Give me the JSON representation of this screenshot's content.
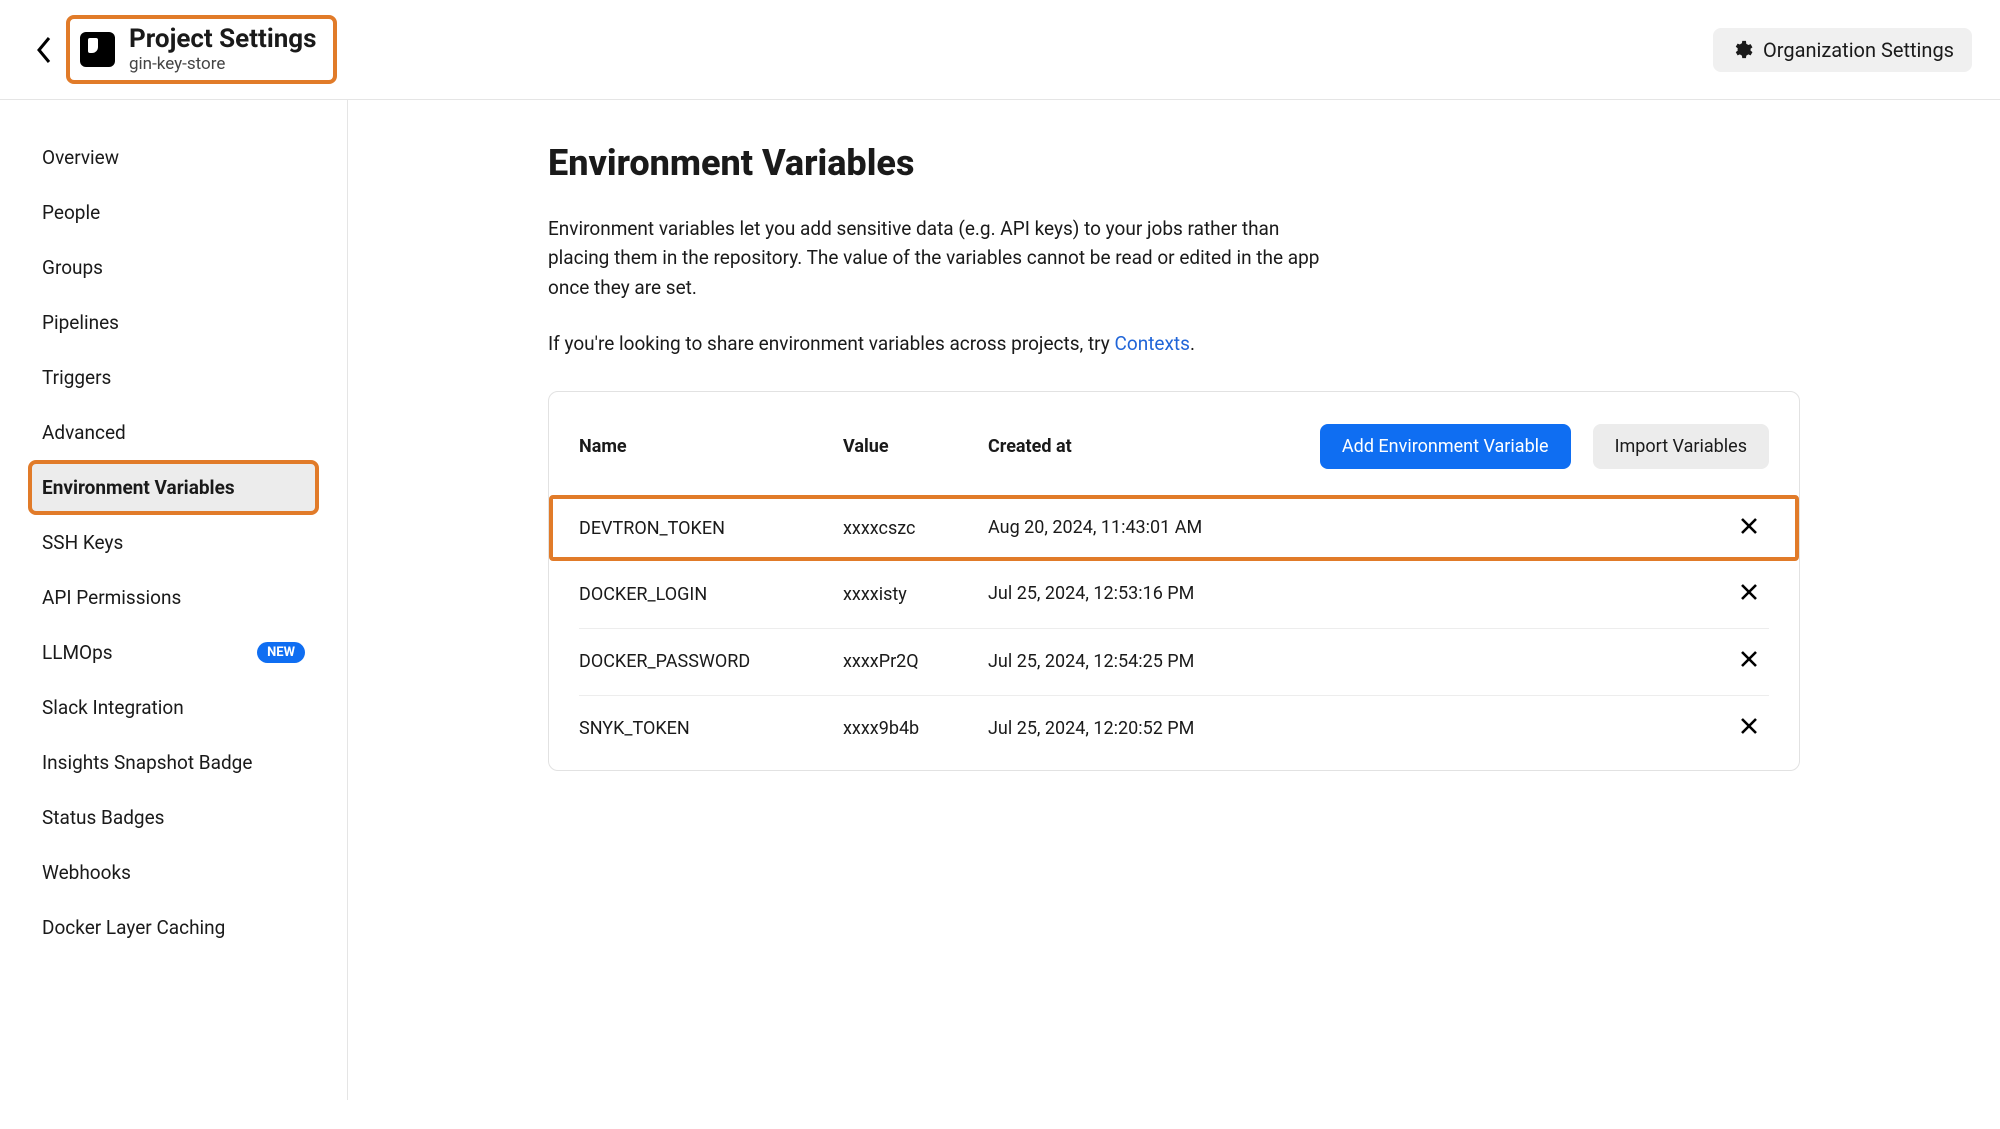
{
  "header": {
    "title": "Project Settings",
    "subtitle": "gin-key-store",
    "org_settings_label": "Organization Settings"
  },
  "sidebar": {
    "items": [
      {
        "label": "Overview"
      },
      {
        "label": "People"
      },
      {
        "label": "Groups"
      },
      {
        "label": "Pipelines"
      },
      {
        "label": "Triggers"
      },
      {
        "label": "Advanced"
      },
      {
        "label": "Environment Variables",
        "active": true
      },
      {
        "label": "SSH Keys"
      },
      {
        "label": "API Permissions"
      },
      {
        "label": "LLMOps",
        "badge": "NEW"
      },
      {
        "label": "Slack Integration"
      },
      {
        "label": "Insights Snapshot Badge"
      },
      {
        "label": "Status Badges"
      },
      {
        "label": "Webhooks"
      },
      {
        "label": "Docker Layer Caching"
      }
    ]
  },
  "main": {
    "heading": "Environment Variables",
    "description": "Environment variables let you add sensitive data (e.g. API keys) to your jobs rather than placing them in the repository. The value of the variables cannot be read or edited in the app once they are set.",
    "hint_prefix": "If you're looking to share environment variables across projects, try ",
    "hint_link": "Contexts",
    "hint_suffix": ".",
    "columns": {
      "name": "Name",
      "value": "Value",
      "created": "Created at"
    },
    "buttons": {
      "add": "Add Environment Variable",
      "import": "Import Variables"
    },
    "rows": [
      {
        "name": "DEVTRON_TOKEN",
        "value": "xxxxcszc",
        "created": "Aug 20, 2024, 11:43:01 AM",
        "highlight": true
      },
      {
        "name": "DOCKER_LOGIN",
        "value": "xxxxisty",
        "created": "Jul 25, 2024, 12:53:16 PM"
      },
      {
        "name": "DOCKER_PASSWORD",
        "value": "xxxxPr2Q",
        "created": "Jul 25, 2024, 12:54:25 PM"
      },
      {
        "name": "SNYK_TOKEN",
        "value": "xxxx9b4b",
        "created": "Jul 25, 2024, 12:20:52 PM"
      }
    ]
  }
}
